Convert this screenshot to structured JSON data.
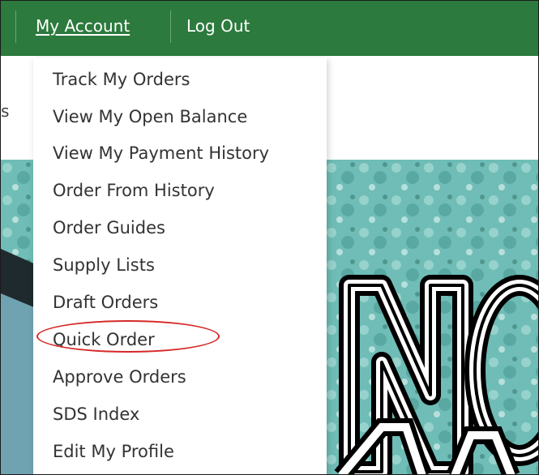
{
  "topbar": {
    "my_account_label": "My Account",
    "log_out_label": "Log Out"
  },
  "page": {
    "left_fragment": "s"
  },
  "dropdown": {
    "items": [
      {
        "label": "Track My Orders"
      },
      {
        "label": "View My Open Balance"
      },
      {
        "label": "View My Payment History"
      },
      {
        "label": "Order From History"
      },
      {
        "label": "Order Guides"
      },
      {
        "label": "Supply Lists"
      },
      {
        "label": "Draft Orders"
      },
      {
        "label": "Quick Order"
      },
      {
        "label": "Approve Orders"
      },
      {
        "label": "SDS Index"
      },
      {
        "label": "Edit My Profile"
      }
    ],
    "highlighted_item": "Quick Order"
  },
  "colors": {
    "topbar": "#2c7a3d",
    "highlight": "#d62828",
    "hero_teal": "#5fb3ad"
  }
}
